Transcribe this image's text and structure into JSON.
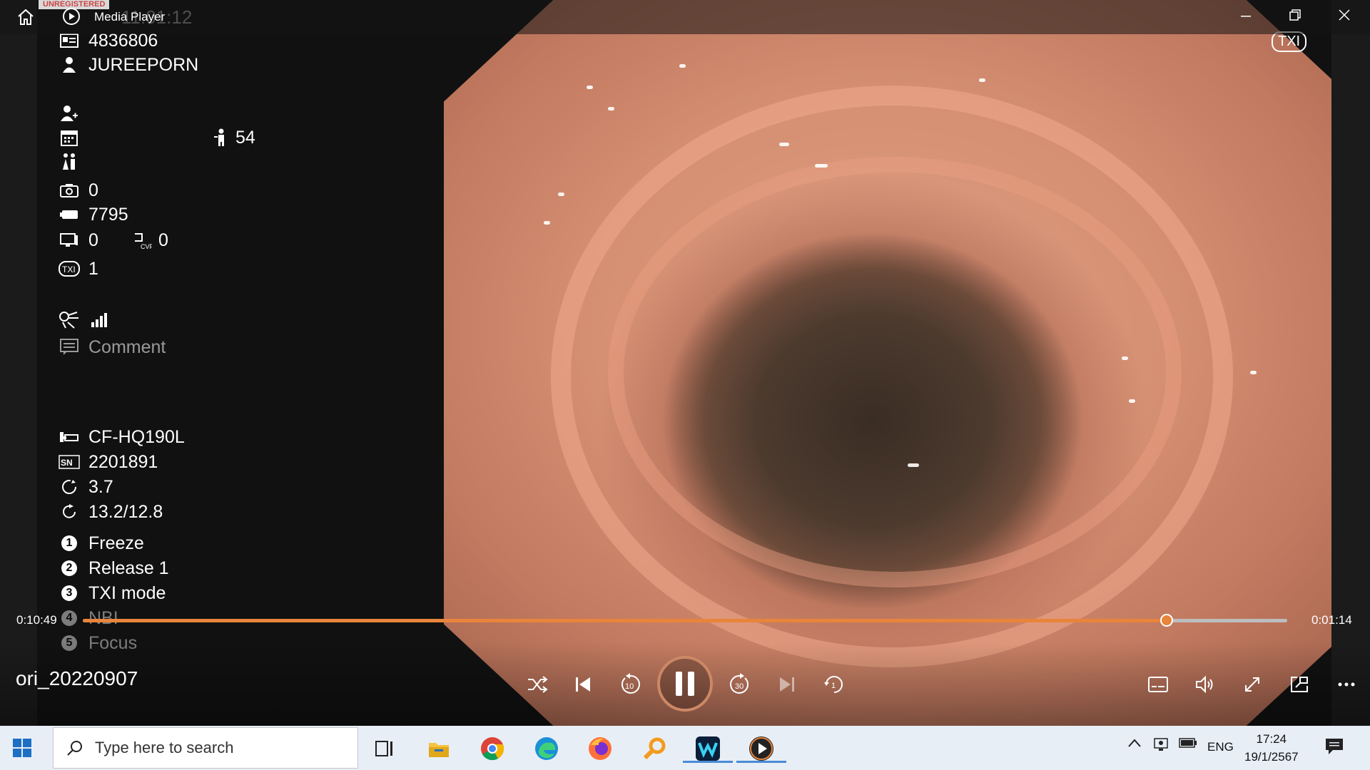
{
  "window": {
    "title": "Media Player",
    "unregistered_label": "UNREGISTERED",
    "ghost_timestamp": "11:01:12"
  },
  "overlay": {
    "patient_id": "4836806",
    "patient_name": "JUREEPORN",
    "age": "54",
    "capture_count": "0",
    "counter": "7795",
    "monitor_value": "0",
    "cvp_value": "0",
    "txi_value": "1",
    "comment": "Comment",
    "scope_model": "CF-HQ190L",
    "serial_number": "2201891",
    "value_1": "3.7",
    "value_2": "13.2/12.8",
    "functions": [
      {
        "num": "1",
        "label": "Freeze"
      },
      {
        "num": "2",
        "label": "Release 1"
      },
      {
        "num": "3",
        "label": "TXI mode"
      },
      {
        "num": "4",
        "label": "NBI"
      },
      {
        "num": "5",
        "label": "Focus"
      }
    ],
    "txi_badge": "TXI"
  },
  "player": {
    "elapsed": "0:10:49",
    "remaining": "0:01:14",
    "progress": 0.9,
    "filename": "ori_20220907",
    "skip_back_label": "10",
    "skip_forward_label": "30",
    "repeat_label": "1"
  },
  "taskbar": {
    "search_placeholder": "Type here to search",
    "language": "ENG",
    "time": "17:24",
    "date": "19/1/2567"
  },
  "colors": {
    "accent": "#e8843b",
    "taskbar_bg": "#e8eef6"
  }
}
